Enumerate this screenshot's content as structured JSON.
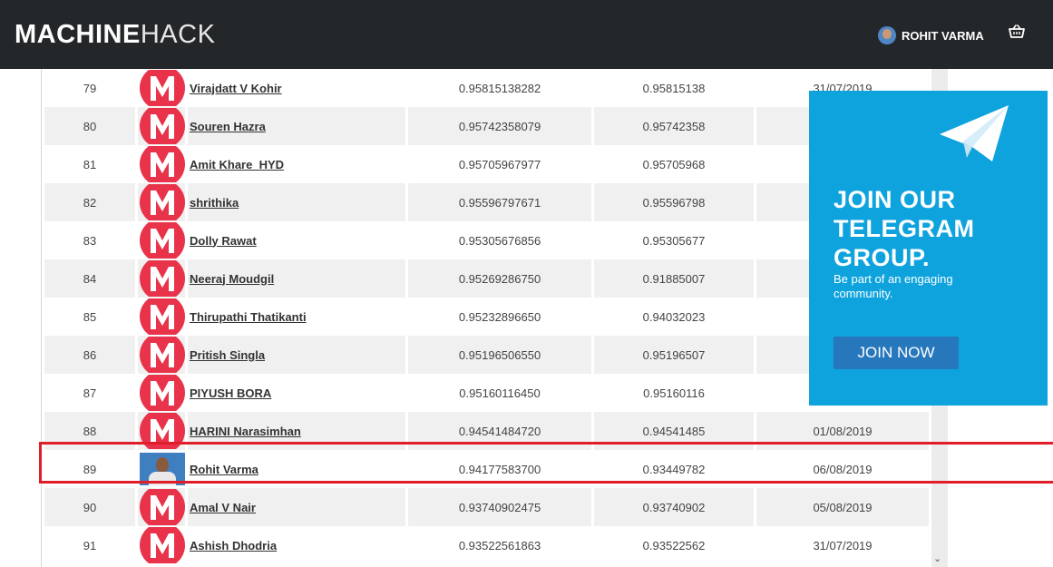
{
  "header": {
    "logo_bold": "MACHINE",
    "logo_light": "HACK",
    "user_name": "ROHIT VARMA",
    "cart_icon": "basket-icon"
  },
  "leaderboard": {
    "rows": [
      {
        "rank": "79",
        "name": "Virajdatt V Kohir",
        "public_score": "0.95815138282",
        "private_score": "0.95815138",
        "date": "31/07/2019",
        "avatar": "machinehack-logo"
      },
      {
        "rank": "80",
        "name": "Souren Hazra",
        "public_score": "0.95742358079",
        "private_score": "0.95742358",
        "date": "",
        "avatar": "machinehack-logo"
      },
      {
        "rank": "81",
        "name": "Amit Khare_HYD",
        "public_score": "0.95705967977",
        "private_score": "0.95705968",
        "date": "",
        "avatar": "machinehack-logo"
      },
      {
        "rank": "82",
        "name": "shrithika",
        "public_score": "0.95596797671",
        "private_score": "0.95596798",
        "date": "",
        "avatar": "machinehack-logo"
      },
      {
        "rank": "83",
        "name": "Dolly Rawat",
        "public_score": "0.95305676856",
        "private_score": "0.95305677",
        "date": "",
        "avatar": "machinehack-logo"
      },
      {
        "rank": "84",
        "name": "Neeraj Moudgil",
        "public_score": "0.95269286750",
        "private_score": "0.91885007",
        "date": "",
        "avatar": "machinehack-logo"
      },
      {
        "rank": "85",
        "name": "Thirupathi Thatikanti",
        "public_score": "0.95232896650",
        "private_score": "0.94032023",
        "date": "",
        "avatar": "machinehack-logo"
      },
      {
        "rank": "86",
        "name": "Pritish Singla",
        "public_score": "0.95196506550",
        "private_score": "0.95196507",
        "date": "",
        "avatar": "machinehack-logo"
      },
      {
        "rank": "87",
        "name": "PIYUSH BORA",
        "public_score": "0.95160116450",
        "private_score": "0.95160116",
        "date": "",
        "avatar": "machinehack-logo"
      },
      {
        "rank": "88",
        "name": "HARINI Narasimhan",
        "public_score": "0.94541484720",
        "private_score": "0.94541485",
        "date": "01/08/2019",
        "avatar": "machinehack-logo"
      },
      {
        "rank": "89",
        "name": "Rohit Varma",
        "public_score": "0.94177583700",
        "private_score": "0.93449782",
        "date": "06/08/2019",
        "avatar": "user-photo",
        "highlighted": true
      },
      {
        "rank": "90",
        "name": "Amal V Nair",
        "public_score": "0.93740902475",
        "private_score": "0.93740902",
        "date": "05/08/2019",
        "avatar": "machinehack-logo"
      },
      {
        "rank": "91",
        "name": "Ashish Dhodria",
        "public_score": "0.93522561863",
        "private_score": "0.93522562",
        "date": "31/07/2019",
        "avatar": "machinehack-logo"
      }
    ]
  },
  "promo": {
    "headline": [
      "JOIN OUR",
      "TELEGRAM",
      "GROUP."
    ],
    "subtext": "Be part of an engaging community.",
    "button_label": "JOIN NOW",
    "icon": "telegram-plane-icon",
    "bg_color": "#0ea3dd",
    "button_color": "#2777bc"
  },
  "colors": {
    "header_bg": "#242729",
    "highlight_border": "#e01e2a",
    "logo_red": "#e8334a"
  }
}
